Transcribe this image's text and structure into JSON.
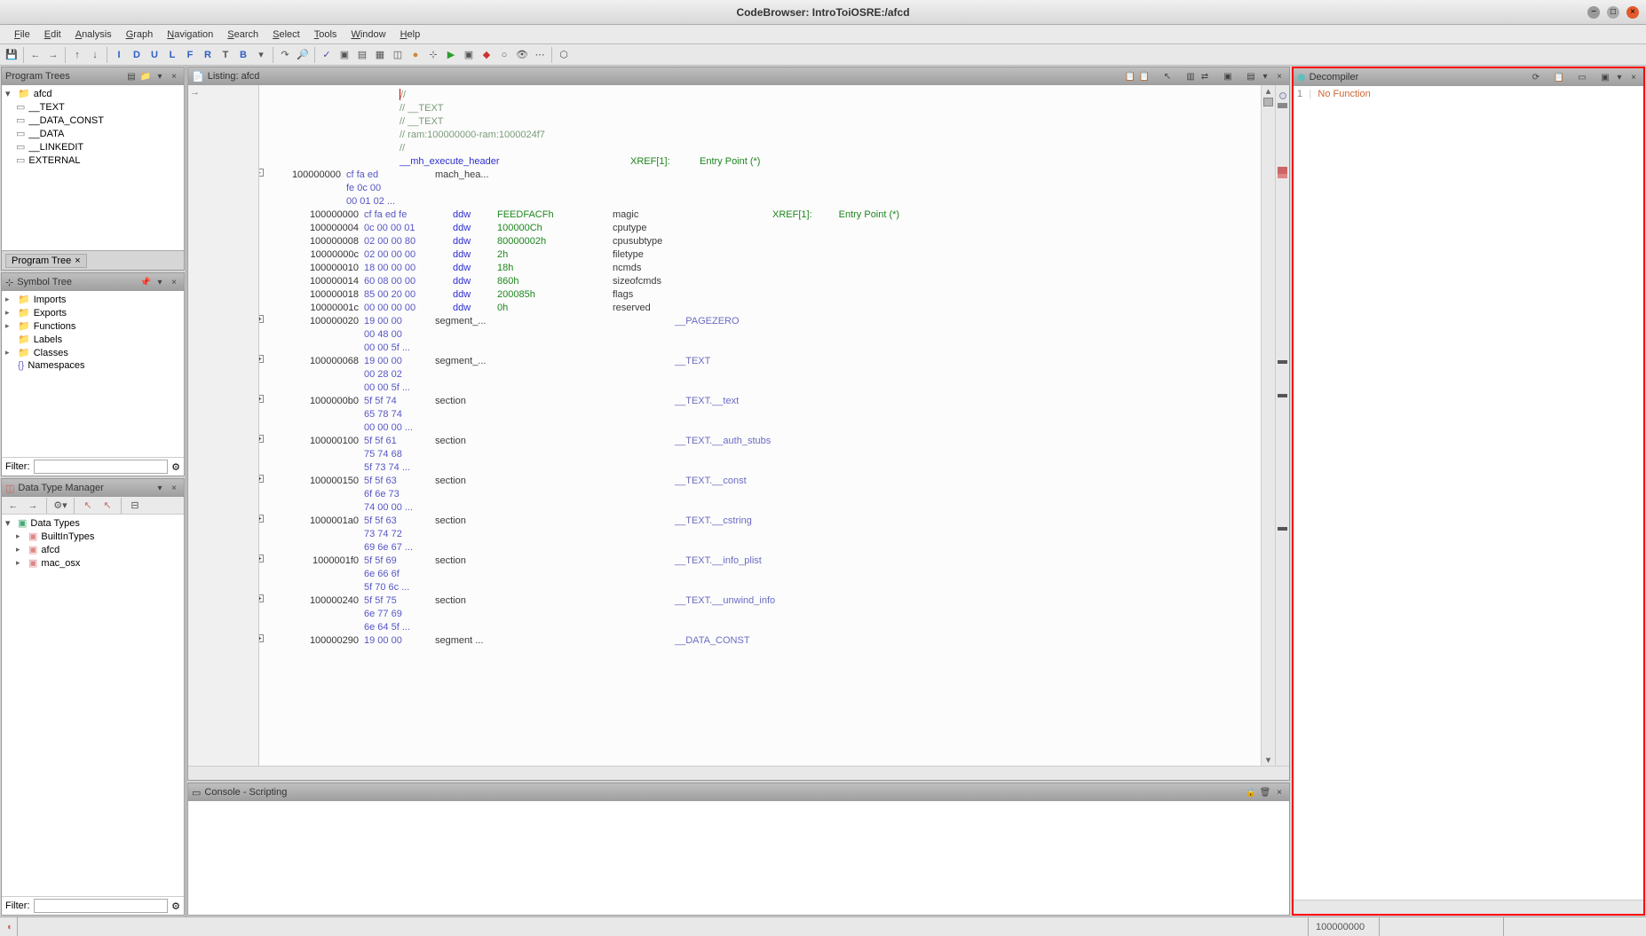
{
  "window": {
    "title": "CodeBrowser: IntroToiOSRE:/afcd"
  },
  "menu": [
    "File",
    "Edit",
    "Analysis",
    "Graph",
    "Navigation",
    "Search",
    "Select",
    "Tools",
    "Window",
    "Help"
  ],
  "program_trees": {
    "title": "Program Trees",
    "root": "afcd",
    "items": [
      "__TEXT",
      "__DATA_CONST",
      "__DATA",
      "__LINKEDIT",
      "EXTERNAL"
    ],
    "tab": "Program Tree"
  },
  "symbol_tree": {
    "title": "Symbol Tree",
    "items": [
      "Imports",
      "Exports",
      "Functions",
      "Labels",
      "Classes",
      "Namespaces"
    ],
    "filter_label": "Filter:"
  },
  "data_type_manager": {
    "title": "Data Type Manager",
    "root": "Data Types",
    "items": [
      "BuiltInTypes",
      "afcd",
      "mac_osx"
    ],
    "filter_label": "Filter:"
  },
  "listing": {
    "title": "Listing:  afcd",
    "comments": [
      "//",
      "// __TEXT",
      "// __TEXT",
      "// ram:100000000-ram:1000024f7",
      "//"
    ],
    "mh_label": "__mh_execute_header",
    "mach_hea": "mach_hea...",
    "xref_label": "XREF[1]:",
    "entry_point": "Entry Point (*)",
    "rows": [
      {
        "addr": "100000000",
        "bytes": "cf fa ed fe",
        "instr": "ddw",
        "op": "FEEDFACFh",
        "field": "magic",
        "xref": "XREF[1]:",
        "ep": "Entry Point (*)"
      },
      {
        "addr": "100000004",
        "bytes": "0c 00 00 01",
        "instr": "ddw",
        "op": "100000Ch",
        "field": "cputype"
      },
      {
        "addr": "100000008",
        "bytes": "02 00 00 80",
        "instr": "ddw",
        "op": "80000002h",
        "field": "cpusubtype"
      },
      {
        "addr": "10000000c",
        "bytes": "02 00 00 00",
        "instr": "ddw",
        "op": "2h",
        "field": "filetype"
      },
      {
        "addr": "100000010",
        "bytes": "18 00 00 00",
        "instr": "ddw",
        "op": "18h",
        "field": "ncmds"
      },
      {
        "addr": "100000014",
        "bytes": "60 08 00 00",
        "instr": "ddw",
        "op": "860h",
        "field": "sizeofcmds"
      },
      {
        "addr": "100000018",
        "bytes": "85 00 20 00",
        "instr": "ddw",
        "op": "200085h",
        "field": "flags"
      },
      {
        "addr": "10000001c",
        "bytes": "00 00 00 00",
        "instr": "ddw",
        "op": "0h",
        "field": "reserved"
      }
    ],
    "header_bytes": [
      "cf fa ed",
      "fe 0c 00",
      "00 01 02 ..."
    ],
    "header_addr": "100000000",
    "segments": [
      {
        "addr": "100000020",
        "bytes": "19 00 00",
        "more": [
          "00 48 00",
          "00 00 5f ..."
        ],
        "type": "segment_...",
        "label": "__PAGEZERO"
      },
      {
        "addr": "100000068",
        "bytes": "19 00 00",
        "more": [
          "00 28 02",
          "00 00 5f ..."
        ],
        "type": "segment_...",
        "label": "__TEXT"
      },
      {
        "addr": "1000000b0",
        "bytes": "5f 5f 74",
        "more": [
          "65 78 74",
          "00 00 00 ..."
        ],
        "type": "section",
        "label": "__TEXT.__text"
      },
      {
        "addr": "100000100",
        "bytes": "5f 5f 61",
        "more": [
          "75 74 68",
          "5f 73 74 ..."
        ],
        "type": "section",
        "label": "__TEXT.__auth_stubs"
      },
      {
        "addr": "100000150",
        "bytes": "5f 5f 63",
        "more": [
          "6f 6e 73",
          "74 00 00 ..."
        ],
        "type": "section",
        "label": "__TEXT.__const"
      },
      {
        "addr": "1000001a0",
        "bytes": "5f 5f 63",
        "more": [
          "73 74 72",
          "69 6e 67 ..."
        ],
        "type": "section",
        "label": "__TEXT.__cstring"
      },
      {
        "addr": "1000001f0",
        "bytes": "5f 5f 69",
        "more": [
          "6e 66 6f",
          "5f 70 6c ..."
        ],
        "type": "section",
        "label": "__TEXT.__info_plist"
      },
      {
        "addr": "100000240",
        "bytes": "5f 5f 75",
        "more": [
          "6e 77 69",
          "6e 64 5f ..."
        ],
        "type": "section",
        "label": "__TEXT.__unwind_info"
      },
      {
        "addr": "100000290",
        "bytes": "19 00 00",
        "more": [],
        "type": "segment ...",
        "label": "__DATA_CONST"
      }
    ]
  },
  "decompiler": {
    "title": "Decompiler",
    "line": "1",
    "text": "No Function"
  },
  "console": {
    "title": "Console - Scripting"
  },
  "status": {
    "address": "100000000"
  }
}
